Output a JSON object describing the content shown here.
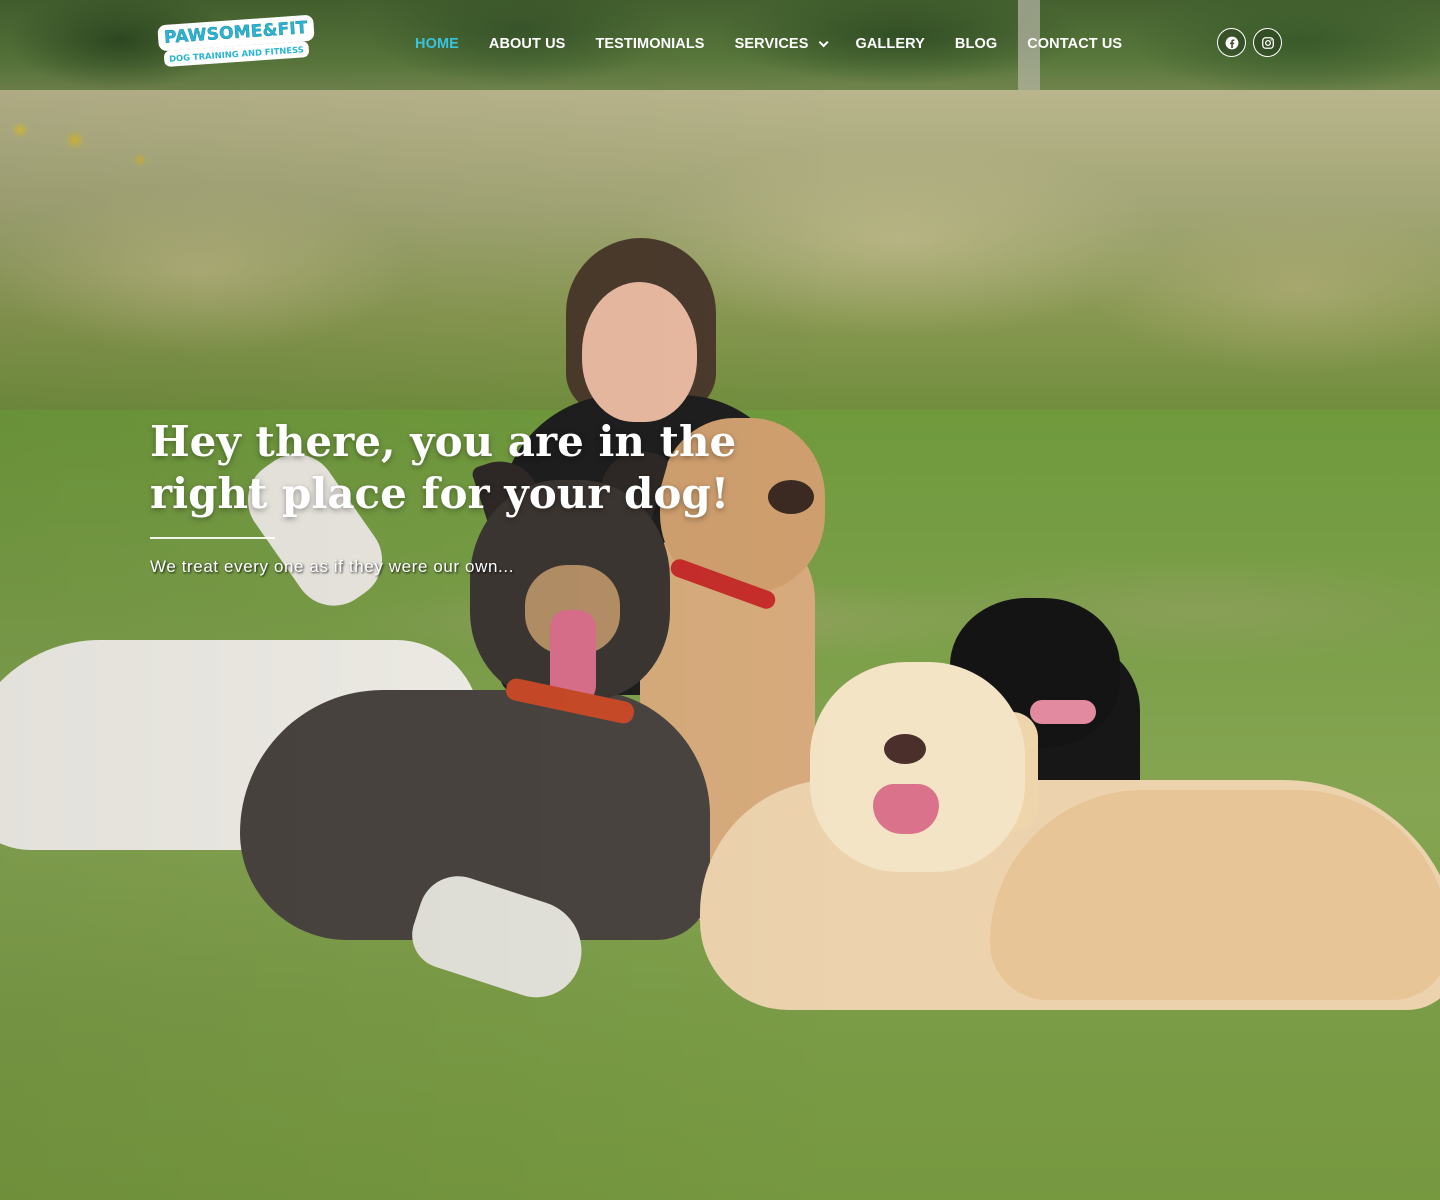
{
  "brand": {
    "logo_top": "PAWSOME&FIT",
    "logo_bottom": "DOG TRAINING AND FITNESS",
    "accent_color": "#38c4dc"
  },
  "nav": {
    "items": [
      {
        "label": "HOME",
        "active": true
      },
      {
        "label": "ABOUT US",
        "active": false
      },
      {
        "label": "TESTIMONIALS",
        "active": false
      },
      {
        "label": "SERVICES",
        "active": false,
        "has_dropdown": true
      },
      {
        "label": "GALLERY",
        "active": false
      },
      {
        "label": "BLOG",
        "active": false
      },
      {
        "label": "CONTACT US",
        "active": false
      }
    ]
  },
  "social": {
    "facebook_icon": "facebook-icon",
    "instagram_icon": "instagram-icon"
  },
  "hero": {
    "title": "Hey there, you are in the right place for your dog!",
    "subtitle": "We treat every one as if they were our own..."
  }
}
